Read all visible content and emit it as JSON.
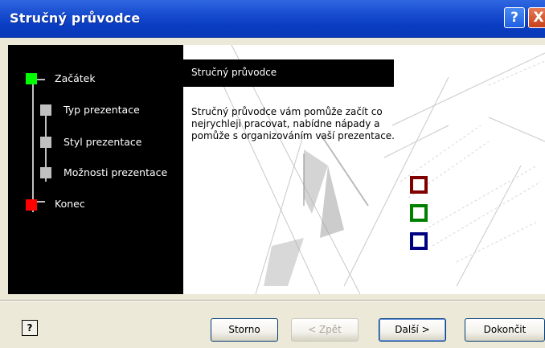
{
  "window": {
    "title": "Stručný průvodce",
    "help_button": "?",
    "close_button": "X"
  },
  "steps": [
    {
      "label": "Začátek",
      "color": "#00ff00"
    },
    {
      "label": "Typ prezentace",
      "color": "#c0c0c0"
    },
    {
      "label": "Styl prezentace",
      "color": "#c0c0c0"
    },
    {
      "label": "Možnosti prezentace",
      "color": "#c0c0c0"
    },
    {
      "label": "Konec",
      "color": "#ff0000"
    }
  ],
  "panel": {
    "heading": "Stručný průvodce",
    "description": "Stručný průvodce vám pomůže začít co nejrychleji pracovat, nabídne nápady a pomůže s organizováním vaší prezentace."
  },
  "buttons": {
    "help_icon": "?",
    "cancel": "Storno",
    "back": "< Zpět",
    "next": "Další >",
    "finish": "Dokončit"
  },
  "colors": {
    "title_bar": "#0a3cc2",
    "box_red": "#800000",
    "box_green": "#008000",
    "box_blue": "#000080"
  }
}
